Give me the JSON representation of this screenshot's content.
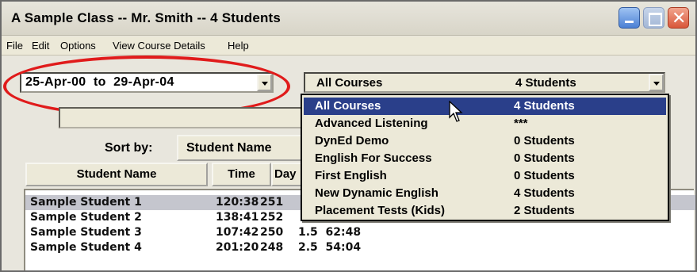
{
  "window": {
    "title": "A Sample Class -- Mr. Smith -- 4 Students"
  },
  "menu": [
    "File",
    "Edit",
    "Options",
    "View Course Details",
    "Help"
  ],
  "date_range": {
    "value": "25-Apr-00  to  29-Apr-04"
  },
  "course_filter": {
    "selected_name": "All Courses",
    "selected_count": "4 Students",
    "options": [
      {
        "name": "All Courses",
        "count": "4 Students"
      },
      {
        "name": "Advanced Listening",
        "count": "***"
      },
      {
        "name": "DynEd Demo",
        "count": "0 Students"
      },
      {
        "name": "English For Success",
        "count": "0 Students"
      },
      {
        "name": "First English",
        "count": "0 Students"
      },
      {
        "name": "New Dynamic English",
        "count": "4 Students"
      },
      {
        "name": "Placement Tests (Kids)",
        "count": "2 Students"
      }
    ],
    "highlighted_index": 0
  },
  "sort": {
    "label": "Sort by:",
    "value": "Student Name"
  },
  "columns": {
    "name": "Student Name",
    "time": "Time",
    "days": "Day"
  },
  "students": [
    {
      "name": "Sample Student 1",
      "time": "120:38",
      "days": "251",
      "avg": "",
      "selected": true
    },
    {
      "name": "Sample Student 2",
      "time": "138:41",
      "days": "252",
      "avg": "",
      "selected": false
    },
    {
      "name": "Sample Student 3",
      "time": "107:42",
      "days": "250",
      "avg": "1.5  62:48",
      "selected": false
    },
    {
      "name": "Sample Student 4",
      "time": "201:20",
      "days": "248",
      "avg": "2.5  54:04",
      "selected": false
    }
  ],
  "colors": {
    "highlight": "#2a3f8a",
    "annotation": "#e01b1b",
    "selected_row": "#c5c6ce"
  }
}
